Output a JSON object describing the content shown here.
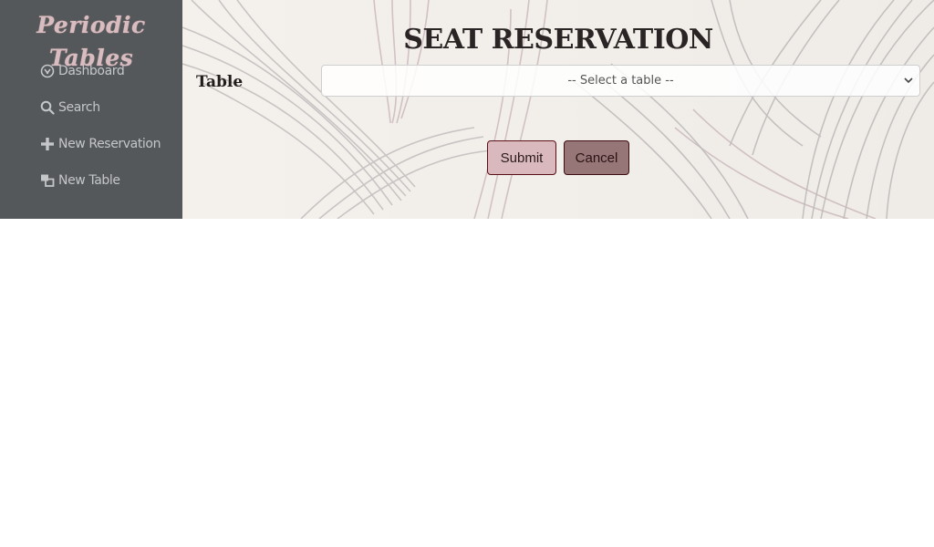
{
  "sidebar": {
    "brand": "Periodic Tables",
    "items": [
      {
        "label": "Dashboard",
        "icon": "dashboard-icon"
      },
      {
        "label": "Search",
        "icon": "search-icon"
      },
      {
        "label": "New Reservation",
        "icon": "plus-icon"
      },
      {
        "label": "New Table",
        "icon": "new-table-icon"
      }
    ]
  },
  "main": {
    "title": "SEAT RESERVATION",
    "form": {
      "table_label": "Table",
      "table_select_value": "-- Select a table --"
    },
    "buttons": {
      "submit": "Submit",
      "cancel": "Cancel"
    }
  },
  "colors": {
    "sidebar_bg": "#55585a",
    "brand": "#d9bcc0",
    "submit_bg": "#d9b9bd",
    "cancel_bg": "#977677"
  }
}
